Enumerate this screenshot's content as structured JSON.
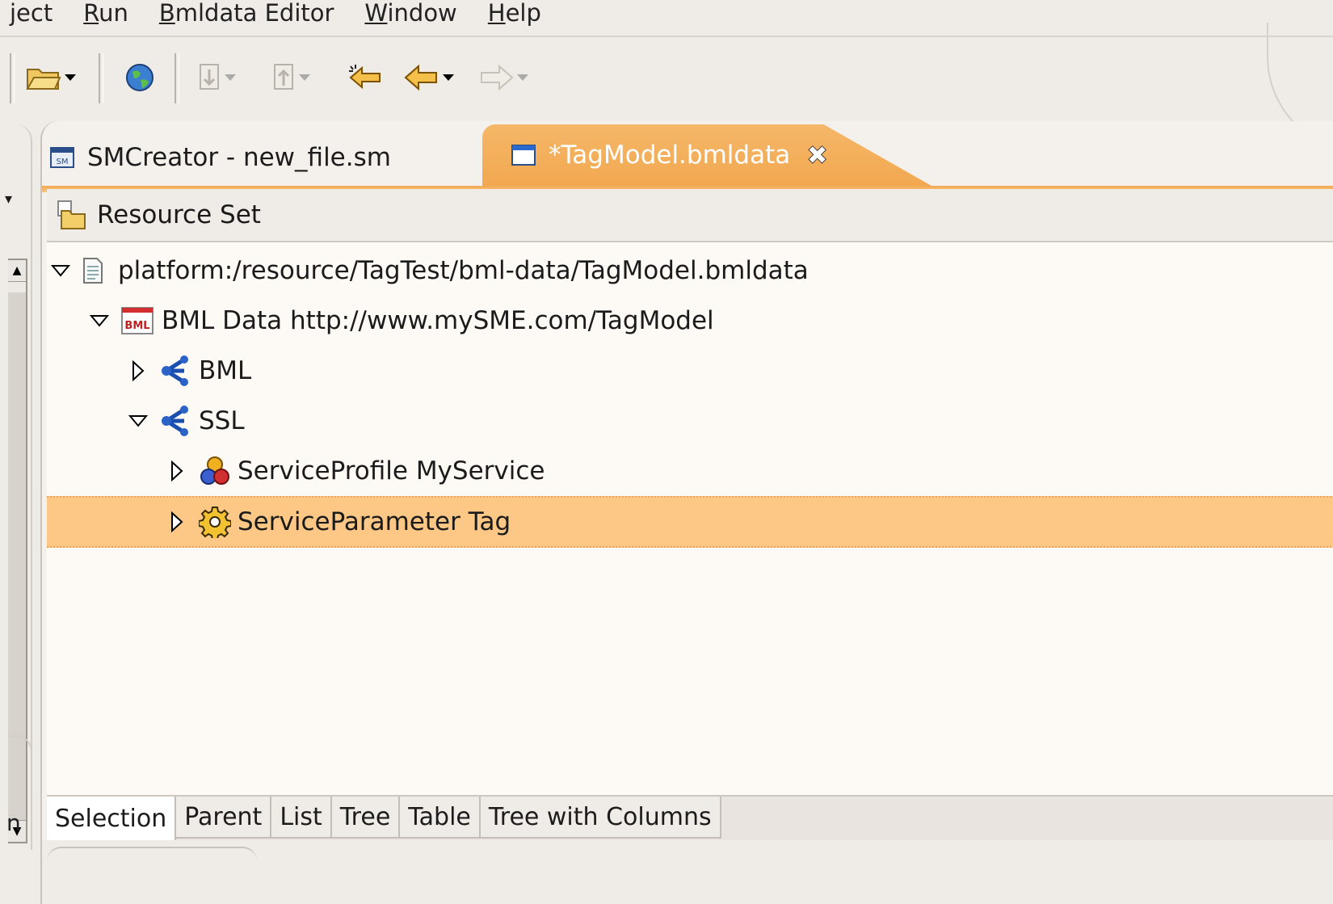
{
  "menu": {
    "items": [
      {
        "label": "ject",
        "mnemonic": "",
        "rest": ""
      },
      {
        "label": "",
        "mnemonic": "R",
        "rest": "un"
      },
      {
        "label": "",
        "mnemonic": "B",
        "rest": "mldata Editor"
      },
      {
        "label": "",
        "mnemonic": "W",
        "rest": "indow"
      },
      {
        "label": "",
        "mnemonic": "H",
        "rest": "elp"
      }
    ]
  },
  "toolbar": {
    "icons": [
      "open-folder-icon",
      "globe-icon",
      "next-annotation-icon",
      "previous-annotation-icon",
      "last-edit-location-icon",
      "back-arrow-icon",
      "forward-arrow-icon"
    ]
  },
  "editor": {
    "tabs": [
      {
        "label": "SMCreator - new_file.sm",
        "icon": "sm-file-icon",
        "active": false
      },
      {
        "label": "*TagModel.bmldata",
        "icon": "editor-window-icon",
        "active": true
      }
    ],
    "header": {
      "label": "Resource Set",
      "icon": "resource-set-folder-icon"
    },
    "tree": [
      {
        "label": "platform:/resource/TagTest/bml-data/TagModel.bmldata",
        "icon": "file-icon",
        "expanded": true,
        "depth": 0
      },
      {
        "label": "BML Data http://www.mySME.com/TagModel",
        "icon": "bml-icon",
        "expanded": true,
        "depth": 1
      },
      {
        "label": "BML",
        "icon": "network-icon",
        "expanded": false,
        "depth": 2
      },
      {
        "label": "SSL",
        "icon": "network-icon",
        "expanded": true,
        "depth": 2
      },
      {
        "label": "ServiceProfile MyService",
        "icon": "service-profile-icon",
        "expanded": false,
        "depth": 3
      },
      {
        "label": "ServiceParameter Tag",
        "icon": "gear-icon",
        "expanded": false,
        "depth": 3,
        "selected": true
      }
    ],
    "bottom_tabs": [
      "Selection",
      "Parent",
      "List",
      "Tree",
      "Table",
      "Tree with Columns"
    ],
    "active_bottom_tab": "Selection"
  },
  "left_strip": {
    "label": "n"
  },
  "colors": {
    "selection": "#fdc785",
    "active_tab": "#f2a850",
    "tree_bg": "#fdfaf5"
  }
}
